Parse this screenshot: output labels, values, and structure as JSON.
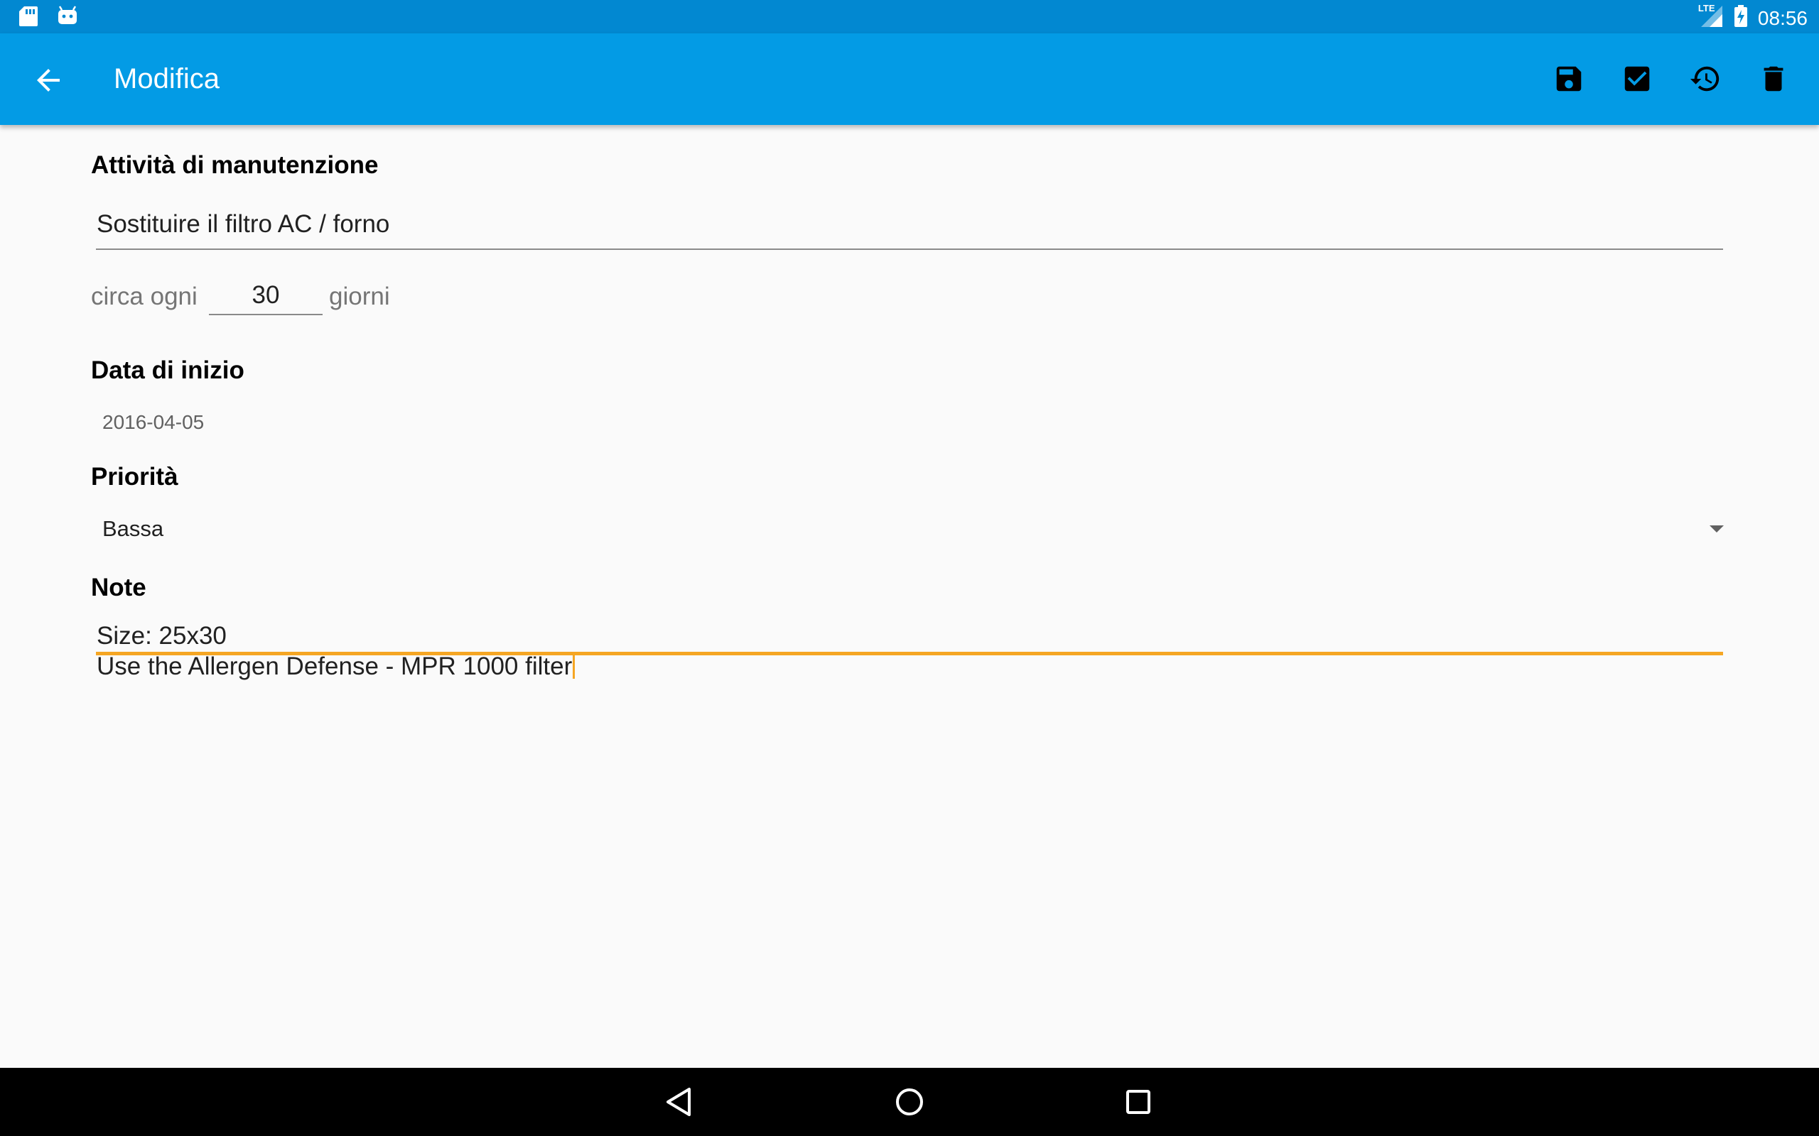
{
  "status_bar": {
    "time": "08:56",
    "network": "LTE",
    "left_icons": [
      "sd-card-icon",
      "android-icon"
    ],
    "right_icons": [
      "signal-icon",
      "battery-charging-icon"
    ]
  },
  "app_bar": {
    "title": "Modifica",
    "actions": [
      "save-icon",
      "check-box-icon",
      "history-icon",
      "delete-icon"
    ],
    "background": "#039be5"
  },
  "form": {
    "activity": {
      "label": "Attività di manutenzione",
      "value": "Sostituire il filtro AC / forno"
    },
    "interval": {
      "prefix": "circa ogni",
      "value": "30",
      "suffix": "giorni"
    },
    "start_date": {
      "label": "Data di inizio",
      "value": "2016-04-05"
    },
    "priority": {
      "label": "Priorità",
      "selected": "Bassa"
    },
    "notes": {
      "label": "Note",
      "line1": "Size: 25x30",
      "line2": "Use the Allergen Defense - MPR 1000 filter"
    }
  },
  "colors": {
    "status_bar": "#0288d1",
    "accent": "#f5a623"
  }
}
